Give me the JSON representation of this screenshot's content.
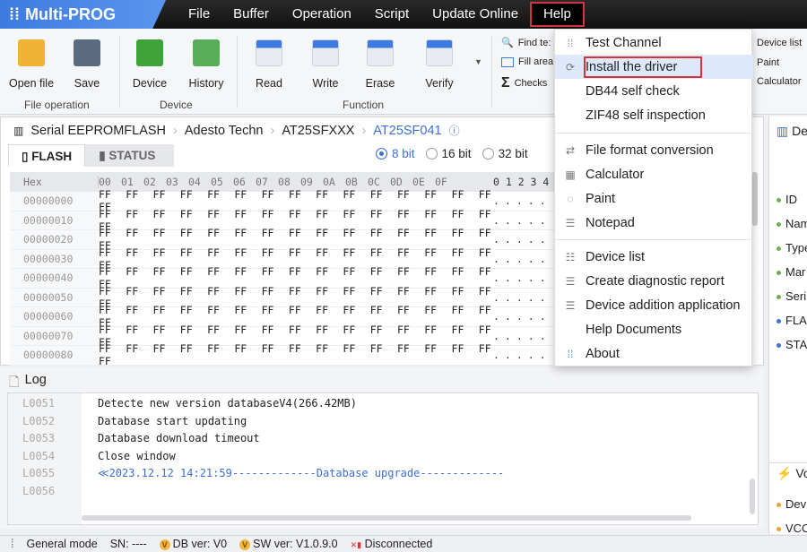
{
  "app": {
    "title": "Multi-PROG"
  },
  "menu": [
    {
      "label": "File"
    },
    {
      "label": "Buffer"
    },
    {
      "label": "Operation"
    },
    {
      "label": "Script"
    },
    {
      "label": "Update Online"
    },
    {
      "label": "Help",
      "active": true
    }
  ],
  "toolbar": {
    "buttons": [
      {
        "label": "Open file",
        "icon": "folder-icon",
        "color": "#f2b233"
      },
      {
        "label": "Save",
        "icon": "floppy-icon",
        "color": "#5b6b7f"
      },
      {
        "label": "Device",
        "icon": "chip-icon",
        "color": "#3fa33a"
      },
      {
        "label": "History",
        "icon": "calendar-icon",
        "color": "#5aad57"
      },
      {
        "label": "Read",
        "icon": "read-icon",
        "color": "#3d7be0"
      },
      {
        "label": "Write",
        "icon": "write-icon",
        "color": "#3d7be0"
      },
      {
        "label": "Erase",
        "icon": "eraser-icon",
        "color": "#3d7be0"
      },
      {
        "label": "Verify",
        "icon": "eye-icon",
        "color": "#3d7be0"
      }
    ],
    "groups": [
      "File operation",
      "Device",
      "Function"
    ],
    "side_left": [
      "Find te:",
      "Fill area",
      "Checks"
    ],
    "side_right": [
      "Device list",
      "Paint",
      "Calculator"
    ]
  },
  "breadcrumb": [
    "Serial EEPROMFLASH",
    "Adesto Techn",
    "AT25SFXXX",
    "AT25SF041"
  ],
  "tabs": [
    "FLASH",
    "STATUS"
  ],
  "bit_options": [
    {
      "label": "8 bit",
      "selected": true
    },
    {
      "label": "16 bit"
    },
    {
      "label": "32 bit"
    }
  ],
  "hex": {
    "header": "Hex",
    "columns": [
      "00",
      "01",
      "02",
      "03",
      "04",
      "05",
      "06",
      "07",
      "08",
      "09",
      "0A",
      "0B",
      "0C",
      "0D",
      "0E",
      "0F"
    ],
    "ascii_header": "0 1 2 3 4",
    "rows": [
      {
        "offset": "00000000",
        "bytes": "FF FF FF FF FF FF FF FF FF FF FF FF FF FF FF FF",
        "ascii": "....."
      },
      {
        "offset": "00000010",
        "bytes": "FF FF FF FF FF FF FF FF FF FF FF FF FF FF FF FF",
        "ascii": "....."
      },
      {
        "offset": "00000020",
        "bytes": "FF FF FF FF FF FF FF FF FF FF FF FF FF FF FF FF",
        "ascii": "....."
      },
      {
        "offset": "00000030",
        "bytes": "FF FF FF FF FF FF FF FF FF FF FF FF FF FF FF FF",
        "ascii": "....."
      },
      {
        "offset": "00000040",
        "bytes": "FF FF FF FF FF FF FF FF FF FF FF FF FF FF FF FF",
        "ascii": "....."
      },
      {
        "offset": "00000050",
        "bytes": "FF FF FF FF FF FF FF FF FF FF FF FF FF FF FF FF",
        "ascii": "....."
      },
      {
        "offset": "00000060",
        "bytes": "FF FF FF FF FF FF FF FF FF FF FF FF FF FF FF FF",
        "ascii": "....."
      },
      {
        "offset": "00000070",
        "bytes": "FF FF FF FF FF FF FF FF FF FF FF FF FF FF FF FF",
        "ascii": "....."
      },
      {
        "offset": "00000080",
        "bytes": "FF FF FF FF FF FF FF FF FF FF FF FF FF FF FF FF",
        "ascii": "....."
      }
    ]
  },
  "log": {
    "title": "Log",
    "lines": [
      {
        "no": "L0051",
        "text": "Detecte new version databaseV4(266.42MB)"
      },
      {
        "no": "L0052",
        "text": "Database start updating"
      },
      {
        "no": "L0053",
        "text": "Database download timeout"
      },
      {
        "no": "L0054",
        "text": "Close window"
      },
      {
        "no": "L0055",
        "text": "≪2023.12.12 14:21:59-------------Database upgrade-------------",
        "highlight": true
      },
      {
        "no": "L0056",
        "text": ""
      }
    ]
  },
  "right_panel": {
    "title": "Dev",
    "items": [
      {
        "label": "ID",
        "color": "#6ab04c"
      },
      {
        "label": "Nam",
        "color": "#6ab04c"
      },
      {
        "label": "Type",
        "color": "#6ab04c"
      },
      {
        "label": "Mar",
        "color": "#6ab04c"
      },
      {
        "label": "Seri",
        "color": "#6ab04c"
      },
      {
        "label": "FLA",
        "color": "#3d6fd6"
      },
      {
        "label": "STA",
        "color": "#3d6fd6"
      }
    ],
    "voltage_title": "Vol",
    "voltage_items": [
      {
        "label": "Dev",
        "color": "#f0a030"
      },
      {
        "label": "VCC",
        "color": "#f0a030"
      }
    ]
  },
  "help_menu": [
    {
      "label": "Test Channel",
      "icon": "channel-icon"
    },
    {
      "label": "Install the driver",
      "icon": "refresh-icon",
      "hover": true
    },
    {
      "label": "DB44 self check",
      "icon": ""
    },
    {
      "label": "ZIF48 self inspection",
      "icon": ""
    },
    {
      "label": "File format conversion",
      "icon": "convert-icon"
    },
    {
      "label": "Calculator",
      "icon": "calculator-icon"
    },
    {
      "label": "Paint",
      "icon": "palette-icon"
    },
    {
      "label": "Notepad",
      "icon": "notepad-icon"
    },
    {
      "label": "Device list",
      "icon": "list-icon"
    },
    {
      "label": "Create diagnostic report",
      "icon": "report-icon"
    },
    {
      "label": "Device addition application",
      "icon": "add-device-icon"
    },
    {
      "label": "Help Documents",
      "icon": ""
    },
    {
      "label": "About",
      "icon": "about-icon"
    }
  ],
  "status": {
    "mode": "General mode",
    "sn": "SN:  ----",
    "db": "DB ver: V0",
    "sw": "SW ver: V1.0.9.0",
    "connection": "Disconnected"
  },
  "colors": {
    "accent": "#3d6fd6",
    "highlight_box": "#d9333a",
    "menubar": "#1a1a1a"
  }
}
